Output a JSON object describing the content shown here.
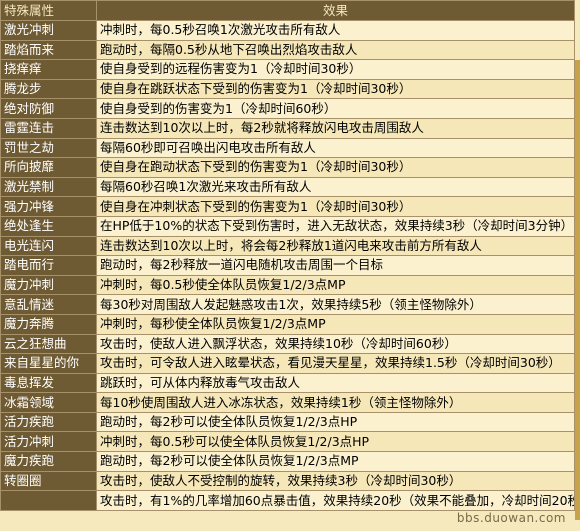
{
  "table": {
    "headers": [
      "特殊属性",
      "效果"
    ],
    "rows": [
      {
        "name": "激光冲刺",
        "effect": "冲刺时，每0.5秒召唤1次激光攻击所有敌人"
      },
      {
        "name": "踏焰而来",
        "effect": "跑动时，每隔0.5秒从地下召唤出烈焰攻击敌人"
      },
      {
        "name": "挠痒痒",
        "effect": "使自身受到的远程伤害变为1（冷却时间30秒）"
      },
      {
        "name": "腾龙步",
        "effect": "使自身在跳跃状态下受到的伤害变为1（冷却时间30秒）"
      },
      {
        "name": "绝对防御",
        "effect": "使自身受到的伤害变为1（冷却时间60秒）"
      },
      {
        "name": "雷霆连击",
        "effect": "连击数达到10次以上时，每2秒就将释放闪电攻击周围敌人"
      },
      {
        "name": "罚世之劫",
        "effect": "每隔60秒即可召唤出闪电攻击所有敌人"
      },
      {
        "name": "所向披靡",
        "effect": "使自身在跑动状态下受到的伤害变为1（冷却时间30秒）"
      },
      {
        "name": "激光禁制",
        "effect": "每隔60秒召唤1次激光来攻击所有敌人"
      },
      {
        "name": "强力冲锋",
        "effect": "使自身在冲刺状态下受到的伤害变为1（冷却时间30秒）"
      },
      {
        "name": "绝处逢生",
        "effect": "在HP低于10%的状态下受到伤害时，进入无敌状态，效果持续3秒（冷却时间3分钟）"
      },
      {
        "name": "电光连闪",
        "effect": "连击数达到10次以上时，将会每2秒释放1道闪电来攻击前方所有敌人"
      },
      {
        "name": "踏电而行",
        "effect": "跑动时，每2秒释放一道闪电随机攻击周围一个目标"
      },
      {
        "name": "魔力冲刺",
        "effect": "冲刺时，每0.5秒使全体队员恢复1/2/3点MP"
      },
      {
        "name": "意乱情迷",
        "effect": "每30秒对周围敌人发起魅惑攻击1次，效果持续5秒（领主怪物除外）"
      },
      {
        "name": "魔力奔腾",
        "effect": "冲刺时，每秒使全体队员恢复1/2/3点MP"
      },
      {
        "name": "云之狂想曲",
        "effect": "攻击时，使敌人进入飘浮状态，效果持续10秒（冷却时间60秒）"
      },
      {
        "name": "来自星星的你",
        "effect": "攻击时，可令敌人进入眩晕状态，看见漫天星星，效果持续1.5秒（冷却时间30秒）"
      },
      {
        "name": "毒息挥发",
        "effect": "跳跃时，可从体内释放毒气攻击敌人"
      },
      {
        "name": "冰霜领域",
        "effect": "每10秒使周围敌人进入冰冻状态，效果持续1秒（领主怪物除外）"
      },
      {
        "name": "活力疾跑",
        "effect": "跑动时，每2秒可以使全体队员恢复1/2/3点HP"
      },
      {
        "name": "活力冲刺",
        "effect": "冲刺时，每0.5秒可以使全体队员恢复1/2/3点HP"
      },
      {
        "name": "魔力疾跑",
        "effect": "跑动时，每2秒可以使全体队员恢复1/2/3点MP"
      },
      {
        "name": "转圈圈",
        "effect": "攻击时，使敌人不受控制的旋转，效果持续3秒（冷却时间30秒）"
      },
      {
        "name": "",
        "effect": "攻击时，有1%的几率增加60点暴击值，效果持续20秒（效果不能叠加，冷却时间20秒）"
      }
    ]
  },
  "watermark": "bbs.duowan.com"
}
